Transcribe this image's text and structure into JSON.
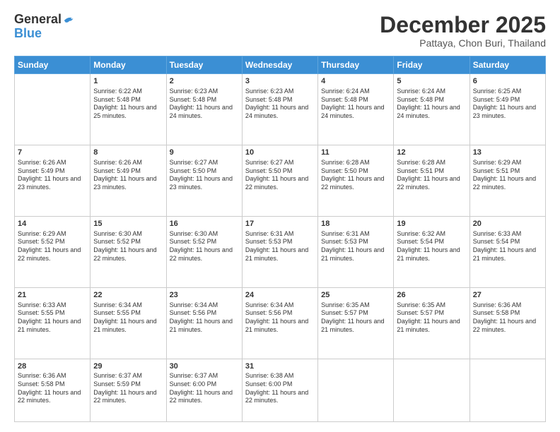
{
  "logo": {
    "general": "General",
    "blue": "Blue"
  },
  "title": "December 2025",
  "location": "Pattaya, Chon Buri, Thailand",
  "days": [
    "Sunday",
    "Monday",
    "Tuesday",
    "Wednesday",
    "Thursday",
    "Friday",
    "Saturday"
  ],
  "weeks": [
    [
      {
        "num": "",
        "text": ""
      },
      {
        "num": "1",
        "sunrise": "6:22 AM",
        "sunset": "5:48 PM",
        "daylight": "11 hours and 25 minutes."
      },
      {
        "num": "2",
        "sunrise": "6:23 AM",
        "sunset": "5:48 PM",
        "daylight": "11 hours and 24 minutes."
      },
      {
        "num": "3",
        "sunrise": "6:23 AM",
        "sunset": "5:48 PM",
        "daylight": "11 hours and 24 minutes."
      },
      {
        "num": "4",
        "sunrise": "6:24 AM",
        "sunset": "5:48 PM",
        "daylight": "11 hours and 24 minutes."
      },
      {
        "num": "5",
        "sunrise": "6:24 AM",
        "sunset": "5:48 PM",
        "daylight": "11 hours and 24 minutes."
      },
      {
        "num": "6",
        "sunrise": "6:25 AM",
        "sunset": "5:49 PM",
        "daylight": "11 hours and 23 minutes."
      }
    ],
    [
      {
        "num": "7",
        "sunrise": "6:26 AM",
        "sunset": "5:49 PM",
        "daylight": "11 hours and 23 minutes."
      },
      {
        "num": "8",
        "sunrise": "6:26 AM",
        "sunset": "5:49 PM",
        "daylight": "11 hours and 23 minutes."
      },
      {
        "num": "9",
        "sunrise": "6:27 AM",
        "sunset": "5:50 PM",
        "daylight": "11 hours and 23 minutes."
      },
      {
        "num": "10",
        "sunrise": "6:27 AM",
        "sunset": "5:50 PM",
        "daylight": "11 hours and 22 minutes."
      },
      {
        "num": "11",
        "sunrise": "6:28 AM",
        "sunset": "5:50 PM",
        "daylight": "11 hours and 22 minutes."
      },
      {
        "num": "12",
        "sunrise": "6:28 AM",
        "sunset": "5:51 PM",
        "daylight": "11 hours and 22 minutes."
      },
      {
        "num": "13",
        "sunrise": "6:29 AM",
        "sunset": "5:51 PM",
        "daylight": "11 hours and 22 minutes."
      }
    ],
    [
      {
        "num": "14",
        "sunrise": "6:29 AM",
        "sunset": "5:52 PM",
        "daylight": "11 hours and 22 minutes."
      },
      {
        "num": "15",
        "sunrise": "6:30 AM",
        "sunset": "5:52 PM",
        "daylight": "11 hours and 22 minutes."
      },
      {
        "num": "16",
        "sunrise": "6:30 AM",
        "sunset": "5:52 PM",
        "daylight": "11 hours and 22 minutes."
      },
      {
        "num": "17",
        "sunrise": "6:31 AM",
        "sunset": "5:53 PM",
        "daylight": "11 hours and 21 minutes."
      },
      {
        "num": "18",
        "sunrise": "6:31 AM",
        "sunset": "5:53 PM",
        "daylight": "11 hours and 21 minutes."
      },
      {
        "num": "19",
        "sunrise": "6:32 AM",
        "sunset": "5:54 PM",
        "daylight": "11 hours and 21 minutes."
      },
      {
        "num": "20",
        "sunrise": "6:33 AM",
        "sunset": "5:54 PM",
        "daylight": "11 hours and 21 minutes."
      }
    ],
    [
      {
        "num": "21",
        "sunrise": "6:33 AM",
        "sunset": "5:55 PM",
        "daylight": "11 hours and 21 minutes."
      },
      {
        "num": "22",
        "sunrise": "6:34 AM",
        "sunset": "5:55 PM",
        "daylight": "11 hours and 21 minutes."
      },
      {
        "num": "23",
        "sunrise": "6:34 AM",
        "sunset": "5:56 PM",
        "daylight": "11 hours and 21 minutes."
      },
      {
        "num": "24",
        "sunrise": "6:34 AM",
        "sunset": "5:56 PM",
        "daylight": "11 hours and 21 minutes."
      },
      {
        "num": "25",
        "sunrise": "6:35 AM",
        "sunset": "5:57 PM",
        "daylight": "11 hours and 21 minutes."
      },
      {
        "num": "26",
        "sunrise": "6:35 AM",
        "sunset": "5:57 PM",
        "daylight": "11 hours and 21 minutes."
      },
      {
        "num": "27",
        "sunrise": "6:36 AM",
        "sunset": "5:58 PM",
        "daylight": "11 hours and 22 minutes."
      }
    ],
    [
      {
        "num": "28",
        "sunrise": "6:36 AM",
        "sunset": "5:58 PM",
        "daylight": "11 hours and 22 minutes."
      },
      {
        "num": "29",
        "sunrise": "6:37 AM",
        "sunset": "5:59 PM",
        "daylight": "11 hours and 22 minutes."
      },
      {
        "num": "30",
        "sunrise": "6:37 AM",
        "sunset": "6:00 PM",
        "daylight": "11 hours and 22 minutes."
      },
      {
        "num": "31",
        "sunrise": "6:38 AM",
        "sunset": "6:00 PM",
        "daylight": "11 hours and 22 minutes."
      },
      {
        "num": "",
        "text": ""
      },
      {
        "num": "",
        "text": ""
      },
      {
        "num": "",
        "text": ""
      }
    ]
  ]
}
